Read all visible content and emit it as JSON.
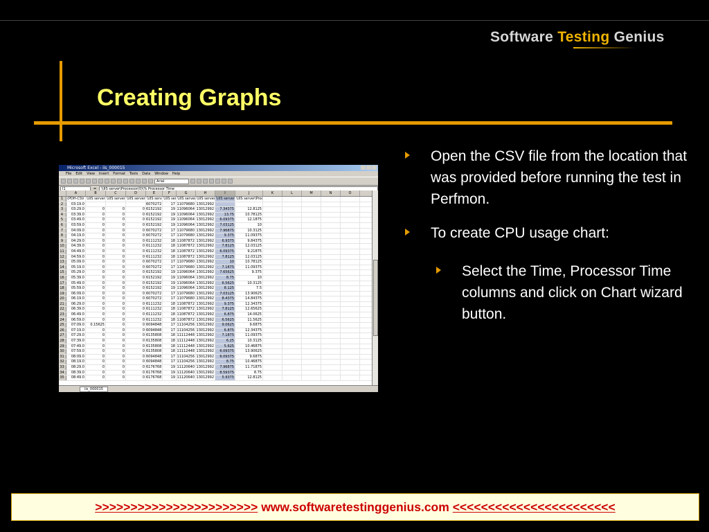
{
  "logo": {
    "part1": "Software ",
    "part2": "Testing",
    "part3": " Genius"
  },
  "slide": {
    "title": "Creating Graphs"
  },
  "bullets": [
    "Open the CSV file from the location that was provided before running the test in Perfmon.",
    "To create CPU usage chart:",
    "Select the Time, Processor Time columns and click on Chart wizard button."
  ],
  "footer": {
    "left": ">>>>>>>>>>>>>>>>>>>>>>>",
    "link": "www.softwaretestinggenius.com",
    "right": "<<<<<<<<<<<<<<<<<<<<<<<"
  },
  "excel": {
    "title": "Microsoft Excel - iis_000015",
    "menus": [
      "File",
      "Edit",
      "View",
      "Insert",
      "Format",
      "Tools",
      "Data",
      "Window",
      "Help"
    ],
    "font": "Arial",
    "name_box": "I1",
    "formula": "\\\\IIS server\\Processor(0)\\% Processor Time",
    "columns": [
      "A",
      "B",
      "C",
      "D",
      "E",
      "F",
      "G",
      "H",
      "I",
      "J",
      "K",
      "L",
      "M",
      "N",
      "O"
    ],
    "header_row": [
      "(PDH-CSV",
      "\\\\IIS server",
      "\\\\IIS server",
      "\\\\IIS server",
      "\\\\IIS server",
      "\\\\IIS server",
      "\\\\IIS server",
      "\\\\IIS server",
      "\\\\IIS server",
      "\\\\IIS server\\Processor(_Total)\\% Processor Time",
      "",
      "",
      "",
      "",
      ""
    ],
    "times": [
      "03:19.0",
      "03:29.0",
      "03:39.0",
      "03:49.0",
      "03:59.0",
      "04:09.0",
      "04:19.0",
      "04:29.0",
      "04:39.0",
      "04:49.0",
      "04:59.0",
      "05:09.0",
      "05:19.0",
      "05:29.0",
      "05:39.0",
      "05:49.0",
      "05:59.0",
      "06:09.0",
      "06:19.0",
      "06:29.0",
      "06:39.0",
      "06:49.0",
      "06:59.0",
      "07:09.0",
      "07:19.0",
      "07:29.0",
      "07:39.0",
      "07:49.0",
      "07:59.0",
      "08:09.0",
      "08:19.0",
      "08:29.0",
      "08:39.0",
      "08:49.0"
    ],
    "col_b": [
      "",
      "0",
      "0",
      "0",
      "0",
      "0",
      "0",
      "0",
      "0",
      "0",
      "0",
      "0",
      "0",
      "0",
      "0",
      "0",
      "0",
      "0",
      "0",
      "0",
      "0",
      "0",
      "0",
      "0.15625",
      "0",
      "0",
      "0",
      "0",
      "0",
      "0",
      "0",
      "0",
      "0",
      "0"
    ],
    "col_c": [
      "",
      "0",
      "0",
      "0",
      "0",
      "0",
      "0",
      "0",
      "0",
      "0",
      "0",
      "0",
      "0",
      "0",
      "0",
      "0",
      "0",
      "0",
      "0",
      "0",
      "0",
      "0",
      "0",
      "0",
      "0",
      "0",
      "0",
      "0",
      "0",
      "0",
      "0",
      "0",
      "0",
      "0"
    ],
    "col_d": [
      "",
      "0",
      "0",
      "0",
      "0",
      "0",
      "0",
      "0",
      "0",
      "0",
      "0",
      "0",
      "0",
      "0",
      "0",
      "0",
      "0",
      "0",
      "0",
      "0",
      "0",
      "0",
      "0",
      "0",
      "0",
      "0",
      "0",
      "0",
      "0",
      "0",
      "0",
      "0",
      "0",
      "0"
    ],
    "col_e": [
      "6070272",
      "6152192",
      "6152192",
      "6152192",
      "6152192",
      "6070272",
      "6070272",
      "6111232",
      "6111232",
      "6111232",
      "6111232",
      "6070272",
      "6070272",
      "6152192",
      "6152192",
      "6152192",
      "6152192",
      "6070272",
      "6070272",
      "6111232",
      "6111232",
      "6111232",
      "6111232",
      "6094848",
      "6094848",
      "6135808",
      "6135808",
      "6135808",
      "6135808",
      "6094848",
      "6094848",
      "6176768",
      "6176768",
      "6176768"
    ],
    "col_f": [
      "17",
      "19",
      "19",
      "19",
      "19",
      "17",
      "17",
      "18",
      "18",
      "18",
      "18",
      "17",
      "17",
      "19",
      "19",
      "19",
      "19",
      "17",
      "17",
      "18",
      "18",
      "18",
      "18",
      "17",
      "17",
      "18",
      "18",
      "18",
      "18",
      "17",
      "17",
      "19",
      "19",
      "19"
    ],
    "col_g": [
      "11079680",
      "11096064",
      "11096064",
      "11096064",
      "11096064",
      "11079680",
      "11079680",
      "11087872",
      "11087872",
      "11087872",
      "11087872",
      "11079680",
      "11079680",
      "11096064",
      "11096064",
      "11096064",
      "11096064",
      "11079680",
      "11079680",
      "11087872",
      "11087872",
      "11087872",
      "11087872",
      "11104256",
      "11104256",
      "11112448",
      "11112448",
      "11112448",
      "11112448",
      "11104256",
      "11104256",
      "11120640",
      "11120640",
      "11120640"
    ],
    "col_h": [
      "13012992",
      "13012992",
      "13012992",
      "13012992",
      "13012992",
      "13012992",
      "13012992",
      "13012992",
      "13012992",
      "13012992",
      "13012992",
      "13012992",
      "13012992",
      "13012992",
      "13012992",
      "13012992",
      "13012992",
      "13012992",
      "13012992",
      "13012992",
      "13012992",
      "13012992",
      "13012992",
      "13012992",
      "13012992",
      "13012992",
      "13012992",
      "13012992",
      "13012992",
      "13012992",
      "13012992",
      "13012992",
      "13012992",
      "13012992"
    ],
    "col_i": [
      "",
      "7.34375",
      "13.75",
      "6.09375",
      "7.03125",
      "7.96875",
      "9.375",
      "6.9375",
      "7.8125",
      "6.09375",
      "7.8125",
      "10",
      "7.1875",
      "7.65625",
      "8.75",
      "6.5625",
      "8.125",
      "7.03125",
      "8.4375",
      "9.375",
      "7.8125",
      "6.875",
      "6.5625",
      "9.0625",
      "6.875",
      "7.1875",
      "6.25",
      "5.625",
      "6.09375",
      "6.09375",
      "8.75",
      "7.96875",
      "8.59375",
      "5.9375"
    ],
    "col_j": [
      "",
      "12.8125",
      "10.78125",
      "12.1875",
      "10",
      "10.3125",
      "11.09375",
      "9.84375",
      "12.03125",
      "9.21875",
      "12.03125",
      "10.78125",
      "11.09375",
      "9.375",
      "10",
      "10.3125",
      "7.5",
      "13.90625",
      "14.84375",
      "12.34375",
      "12.65625",
      "14.0625",
      "11.5625",
      "9.6875",
      "12.34375",
      "11.09375",
      "10.3125",
      "10.46875",
      "13.90625",
      "9.6875",
      "10.46875",
      "11.71875",
      "8.75",
      "12.8125"
    ],
    "sheet_tab": "iis_000015"
  }
}
